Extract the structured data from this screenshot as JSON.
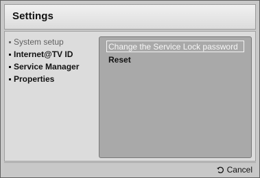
{
  "window": {
    "title": "Settings"
  },
  "menu": {
    "items": [
      {
        "label": "System setup",
        "selected": true
      },
      {
        "label": "Internet@TV ID",
        "selected": false
      },
      {
        "label": "Service Manager",
        "selected": false
      },
      {
        "label": "Properties",
        "selected": false
      }
    ]
  },
  "detail": {
    "options": [
      {
        "label": "Change the Service Lock password",
        "focused": true
      },
      {
        "label": "Reset",
        "focused": false
      }
    ]
  },
  "footer": {
    "cancel_label": "Cancel",
    "cancel_icon": "return-arrow-icon"
  }
}
